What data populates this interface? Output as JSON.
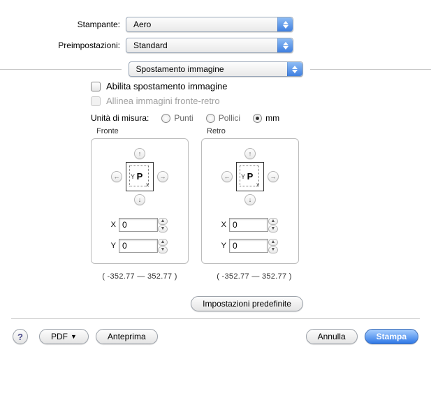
{
  "printer": {
    "label": "Stampante:",
    "value": "Aero"
  },
  "presets": {
    "label": "Preimpostazioni:",
    "value": "Standard"
  },
  "section": {
    "value": "Spostamento immagine"
  },
  "options": {
    "enable_shift": "Abilita spostamento immagine",
    "align_duplex": "Allinea immagini fronte-retro",
    "units_label": "Unità di misura:",
    "unit_points": "Punti",
    "unit_inches": "Pollici",
    "unit_mm": "mm"
  },
  "front": {
    "title": "Fronte",
    "x_label": "X",
    "y_label": "Y",
    "x_value": "0",
    "y_value": "0",
    "range": "( -352.77   —   352.77 )"
  },
  "back": {
    "title": "Retro",
    "x_label": "X",
    "y_label": "Y",
    "x_value": "0",
    "y_value": "0",
    "range": "( -352.77   —   352.77 )"
  },
  "page_preview": {
    "y": "Y",
    "p": "P",
    "x": "x"
  },
  "buttons": {
    "defaults": "Impostazioni predefinite",
    "pdf": "PDF",
    "preview": "Anteprima",
    "cancel": "Annulla",
    "print": "Stampa"
  },
  "help": "?"
}
